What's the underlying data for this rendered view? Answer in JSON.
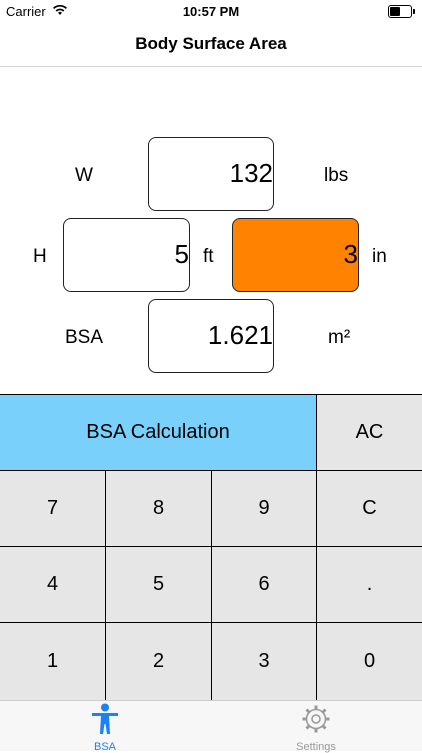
{
  "status": {
    "carrier": "Carrier",
    "time": "10:57 PM",
    "battery_level": 0.5
  },
  "nav": {
    "title": "Body Surface Area"
  },
  "weight": {
    "label": "W",
    "value": "132",
    "unit": "lbs"
  },
  "height": {
    "label": "H",
    "feet_value": "5",
    "feet_unit": "ft",
    "inches_value": "3",
    "inches_unit": "in"
  },
  "bsa": {
    "label": "BSA",
    "value": "1.621",
    "unit": "m²"
  },
  "keypad": {
    "calc_label": "BSA Calculation",
    "ac_label": "AC",
    "rows": [
      [
        "7",
        "8",
        "9",
        "C"
      ],
      [
        "4",
        "5",
        "6",
        "."
      ],
      [
        "1",
        "2",
        "3",
        "0"
      ]
    ]
  },
  "tabs": [
    {
      "label": "BSA",
      "icon": "person-icon"
    },
    {
      "label": "Settings",
      "icon": "gear-icon"
    }
  ],
  "colors": {
    "active_field": "#ff8200",
    "calc_button": "#79d1fb",
    "tab_active": "#1a82f6",
    "key_bg": "#e6e6e6"
  }
}
